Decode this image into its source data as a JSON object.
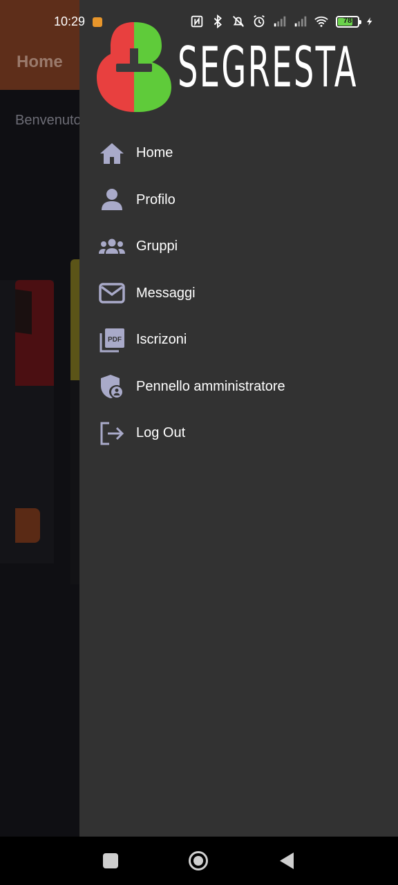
{
  "status_bar": {
    "time": "10:29",
    "battery_level": "78",
    "battery_fraction": 0.78
  },
  "background": {
    "appbar_title": "Home",
    "welcome_text": "Benvenuto iscriverti, tuo profilo"
  },
  "drawer": {
    "brand_name": "SEGRESTA",
    "logo_colors": {
      "left": "#e8403f",
      "right": "#5fcb3a",
      "cross": "#3a3a3a"
    },
    "icon_color": "#a9aac9",
    "items": [
      {
        "label": "Home",
        "icon": "home-icon"
      },
      {
        "label": "Profilo",
        "icon": "person-icon"
      },
      {
        "label": "Gruppi",
        "icon": "group-icon"
      },
      {
        "label": "Messaggi",
        "icon": "envelope-icon"
      },
      {
        "label": "Iscrizoni",
        "icon": "pdf-icon"
      },
      {
        "label": "Pennello amministratore",
        "icon": "admin-shield-icon"
      },
      {
        "label": "Log Out",
        "icon": "logout-icon"
      }
    ]
  },
  "nav_bar": {
    "buttons": [
      "recents-button",
      "home-button",
      "back-button"
    ]
  }
}
